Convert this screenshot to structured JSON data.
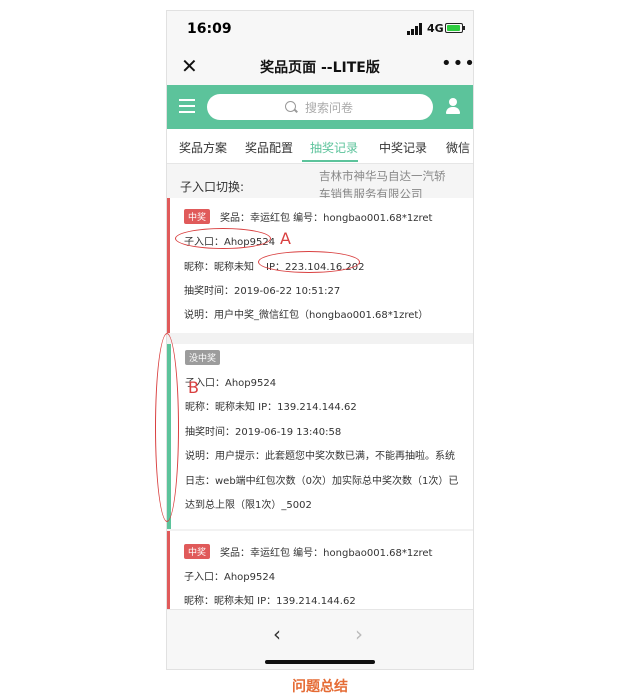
{
  "status": {
    "time": "16:09",
    "network": "4G"
  },
  "nav": {
    "title": "奖品页面 --LITE版"
  },
  "search": {
    "placeholder": "搜索问卷"
  },
  "tabs": [
    {
      "label": "奖品方案"
    },
    {
      "label": "奖品配置"
    },
    {
      "label": "抽奖记录"
    },
    {
      "label": "中奖记录"
    },
    {
      "label": "微信"
    }
  ],
  "switch": {
    "label": "子入口切换:",
    "company_line1": "吉林市神华马自达一汽轿",
    "company_line2": "车销售服务有限公司"
  },
  "records": [
    {
      "badge": "中奖",
      "line1": "奖品：幸运红包    编号：hongbao001.68*1zret",
      "entry": "子入口：Ahop9524",
      "nickname": "昵称：昵称未知",
      "ip": "IP：223.104.16.202",
      "time": "抽奖时间：2019-06-22 10:51:27",
      "note": "说明：用户中奖_微信红包（hongbao001.68*1zret）"
    },
    {
      "badge": "没中奖",
      "entry": "子入口：Ahop9524",
      "nickname_ip": "昵称：昵称未知    IP：139.214.144.62",
      "time": "抽奖时间：2019-06-19 13:40:58",
      "note1": "说明：用户提示：此套题您中奖次数已满，不能再抽啦。系统",
      "note2": "日志：web端中红包次数（0次）加实际总中奖次数（1次）已",
      "note3": "达到总上限（限1次）_5002"
    },
    {
      "badge": "中奖",
      "line1": "奖品：幸运红包    编号：hongbao001.68*1zret",
      "entry": "子入口：Ahop9524",
      "nickname_ip": "昵称：昵称未知    IP：139.214.144.62"
    }
  ],
  "bottom": {
    "back": "‹",
    "forward": "›"
  },
  "annotations": {
    "a": "A",
    "b": "B"
  },
  "caption": "问题总结",
  "colors": {
    "accent": "#5cc39b",
    "win_red": "#e05a5a",
    "annotation": "#d94040",
    "caption": "#e56b34"
  }
}
